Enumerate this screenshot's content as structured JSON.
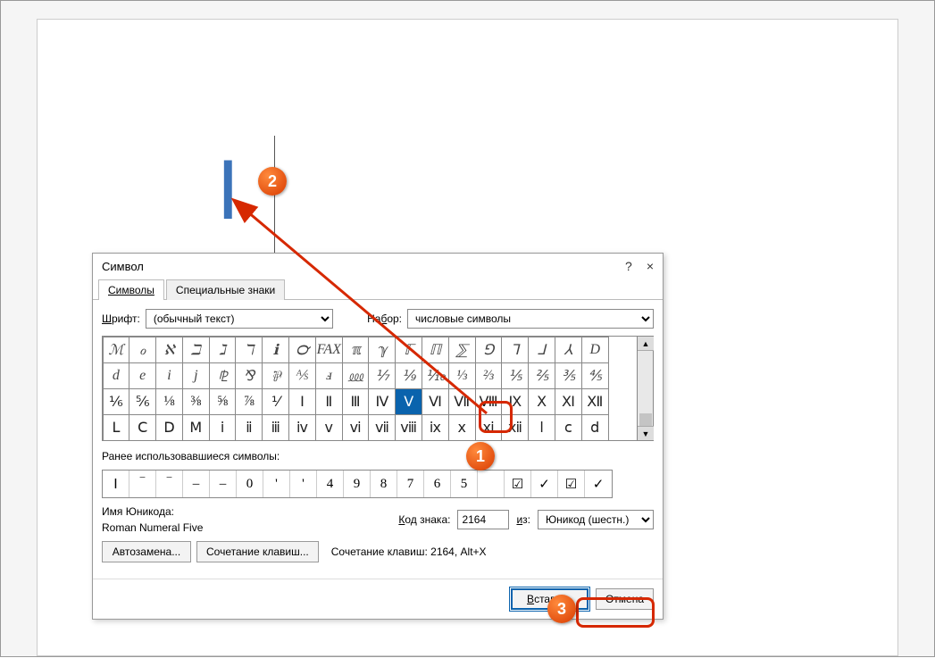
{
  "document": {
    "inserted_char": "Ⅰ"
  },
  "dialog": {
    "title": "Символ",
    "help": "?",
    "close": "×",
    "tabs": {
      "symbols": "Символы",
      "special": "Специальные знаки"
    },
    "font_label": "Шрифт:",
    "font_value": "(обычный текст)",
    "subset_label": "Набор:",
    "subset_value": "числовые символы",
    "grid": [
      [
        "ℳ",
        "ℴ",
        "ℵ",
        "ℶ",
        "ℷ",
        "ℸ",
        "ℹ",
        "℺",
        "FAX",
        "ℼ",
        "ℽ",
        "ℾ",
        "ℿ",
        "⅀",
        "⅁",
        "⅂",
        "⅃",
        "⅄",
        "D"
      ],
      [
        "d",
        "e",
        "i",
        "j",
        "⅊",
        "⅋",
        "⅌",
        "⅍",
        "ⅎ",
        "⅏",
        "⅐",
        "⅑",
        "⅒",
        "⅓",
        "⅔",
        "⅕",
        "⅖",
        "⅗",
        "⅘"
      ],
      [
        "⅙",
        "⅚",
        "⅛",
        "⅜",
        "⅝",
        "⅞",
        "⅟",
        "Ⅰ",
        "Ⅱ",
        "Ⅲ",
        "Ⅳ",
        "Ⅴ",
        "Ⅵ",
        "Ⅶ",
        "Ⅷ",
        "Ⅸ",
        "Ⅹ",
        "Ⅺ",
        "Ⅻ"
      ],
      [
        "Ⅼ",
        "Ⅽ",
        "Ⅾ",
        "Ⅿ",
        "ⅰ",
        "ⅱ",
        "ⅲ",
        "ⅳ",
        "ⅴ",
        "ⅵ",
        "ⅶ",
        "ⅷ",
        "ⅸ",
        "ⅹ",
        "ⅺ",
        "ⅻ",
        "ⅼ",
        "ⅽ",
        "ⅾ"
      ]
    ],
    "selected_cell": {
      "row": 2,
      "col": 11
    },
    "recent_label": "Ранее использовавшиеся символы:",
    "recent": [
      "Ⅰ",
      "‾",
      "‾",
      "‒",
      "–",
      "0",
      "'",
      "'",
      "4",
      "9",
      "8",
      "7",
      "6",
      "5",
      "",
      "☑",
      "✓",
      "☑",
      "✓"
    ],
    "unicode_name_label": "Имя Юникода:",
    "unicode_name": "Roman Numeral Five",
    "code_label": "Код знака:",
    "code_value": "2164",
    "from_label": "из:",
    "from_value": "Юникод (шестн.)",
    "autocorrect_btn": "Автозамена...",
    "shortcut_btn": "Сочетание клавиш...",
    "shortcut_text": "Сочетание клавиш: 2164, Alt+X",
    "insert_btn": "Вставить",
    "cancel_btn": "Отмена"
  },
  "annotations": {
    "n1": "1",
    "n2": "2",
    "n3": "3"
  }
}
